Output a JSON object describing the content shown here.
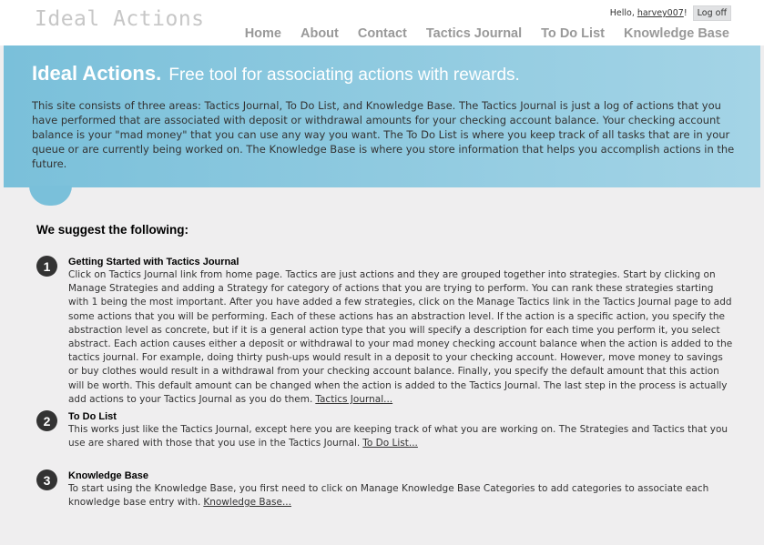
{
  "header": {
    "site_title": "Ideal Actions",
    "greeting": "Hello,",
    "username": "harvey007",
    "greeting_suffix": "!",
    "logoff_label": "Log off"
  },
  "menu": {
    "items": [
      {
        "label": "Home"
      },
      {
        "label": "About"
      },
      {
        "label": "Contact"
      },
      {
        "label": "Tactics Journal"
      },
      {
        "label": "To Do List"
      },
      {
        "label": "Knowledge Base"
      }
    ]
  },
  "featured": {
    "title": "Ideal Actions.",
    "tagline": "Free tool for associating actions with rewards.",
    "description": "This site consists of three areas: Tactics Journal, To Do List, and Knowledge Base. The Tactics Journal is just a log of actions that you have performed that are associated with deposit or withdrawal amounts for your checking account balance. Your checking account balance is your \"mad money\" that you can use any way you want. The To Do List is where you keep track of all tasks that are in your queue or are currently being worked on. The Knowledge Base is where you store information that helps you accomplish actions in the future."
  },
  "main": {
    "heading": "We suggest the following:",
    "steps": [
      {
        "number": "1",
        "title": "Getting Started with Tactics Journal",
        "text": "Click on Tactics Journal link from home page. Tactics are just actions and they are grouped together into strategies. Start by clicking on Manage Strategies and adding a Strategy for category of actions that you are trying to perform. You can rank these strategies starting with 1 being the most important. After you have added a few strategies, click on the Manage Tactics link in the Tactics Journal page to add some actions that you will be performing. Each of these actions has an abstraction level. If the action is a specific action, you specify the abstraction level as concrete, but if it is a general action type that you will specify a description for each time you perform it, you select abstract. Each action causes either a deposit or withdrawal to your mad money checking account balance when the action is added to the tactics journal. For example, doing thirty push-ups would result in a deposit to your checking account. However, move money to savings or buy clothes would result in a withdrawal from your checking account balance. Finally, you specify the default amount that this action will be worth. This default amount can be changed when the action is added to the Tactics Journal. The last step in the process is actually add actions to your Tactics Journal as you do them.",
        "link": "Tactics Journal..."
      },
      {
        "number": "2",
        "title": "To Do List",
        "text": "This works just like the Tactics Journal, except here you are keeping track of what you are working on. The Strategies and Tactics that you use are shared with those that you use in the Tactics Journal.",
        "link": "To Do List..."
      },
      {
        "number": "3",
        "title": "Knowledge Base",
        "text": "To start using the Knowledge Base, you first need to click on Manage Knowledge Base Categories to add categories to associate each knowledge base entry with.",
        "link": "Knowledge Base..."
      }
    ]
  },
  "colors": {
    "banner_start": "#7ac0da",
    "banner_end": "#a4d4e6",
    "page_background": "#efeeef",
    "step_number_background": "#333333"
  }
}
